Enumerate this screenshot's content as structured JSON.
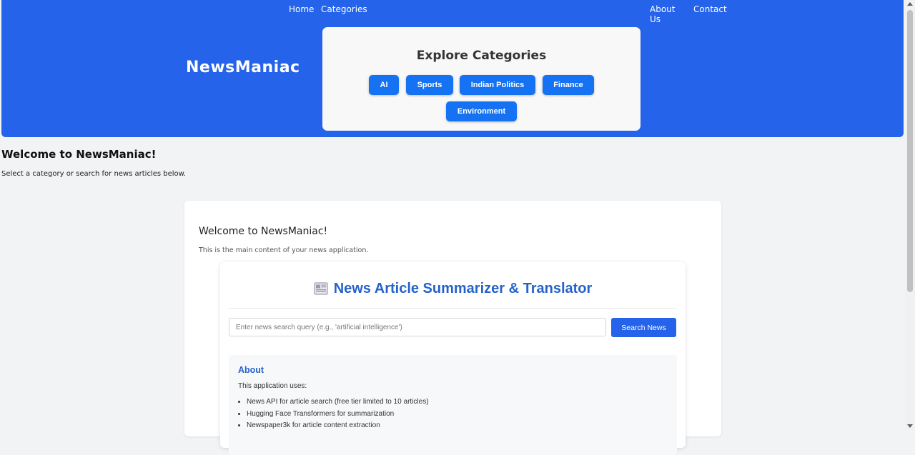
{
  "header": {
    "brand": "NewsManiac",
    "nav": {
      "home": "Home",
      "categories": "Categories",
      "about_line1": "About",
      "about_line2": "Us",
      "contact": "Contact"
    },
    "categories_card": {
      "title": "Explore Categories",
      "buttons": [
        "AI",
        "Sports",
        "Indian Politics",
        "Finance",
        "Environment"
      ]
    }
  },
  "welcome": {
    "heading": "Welcome to NewsManiac!",
    "subtext": "Select a category or search for news articles below."
  },
  "main": {
    "title": "Welcome to NewsManiac!",
    "description": "This is the main content of your news application.",
    "app": {
      "icon": "newspaper-icon",
      "title": "News Article Summarizer & Translator",
      "search_placeholder": "Enter news search query (e.g., 'artificial intelligence')",
      "search_button": "Search News",
      "about": {
        "heading": "About",
        "intro": "This application uses:",
        "items": [
          "News API for article search (free tier limited to 10 articles)",
          "Hugging Face Transformers for summarization",
          "Newspaper3k for article content extraction"
        ]
      }
    }
  },
  "colors": {
    "header_bg": "#2563eb",
    "category_button": "#1573f3",
    "app_title": "#2563c9"
  }
}
